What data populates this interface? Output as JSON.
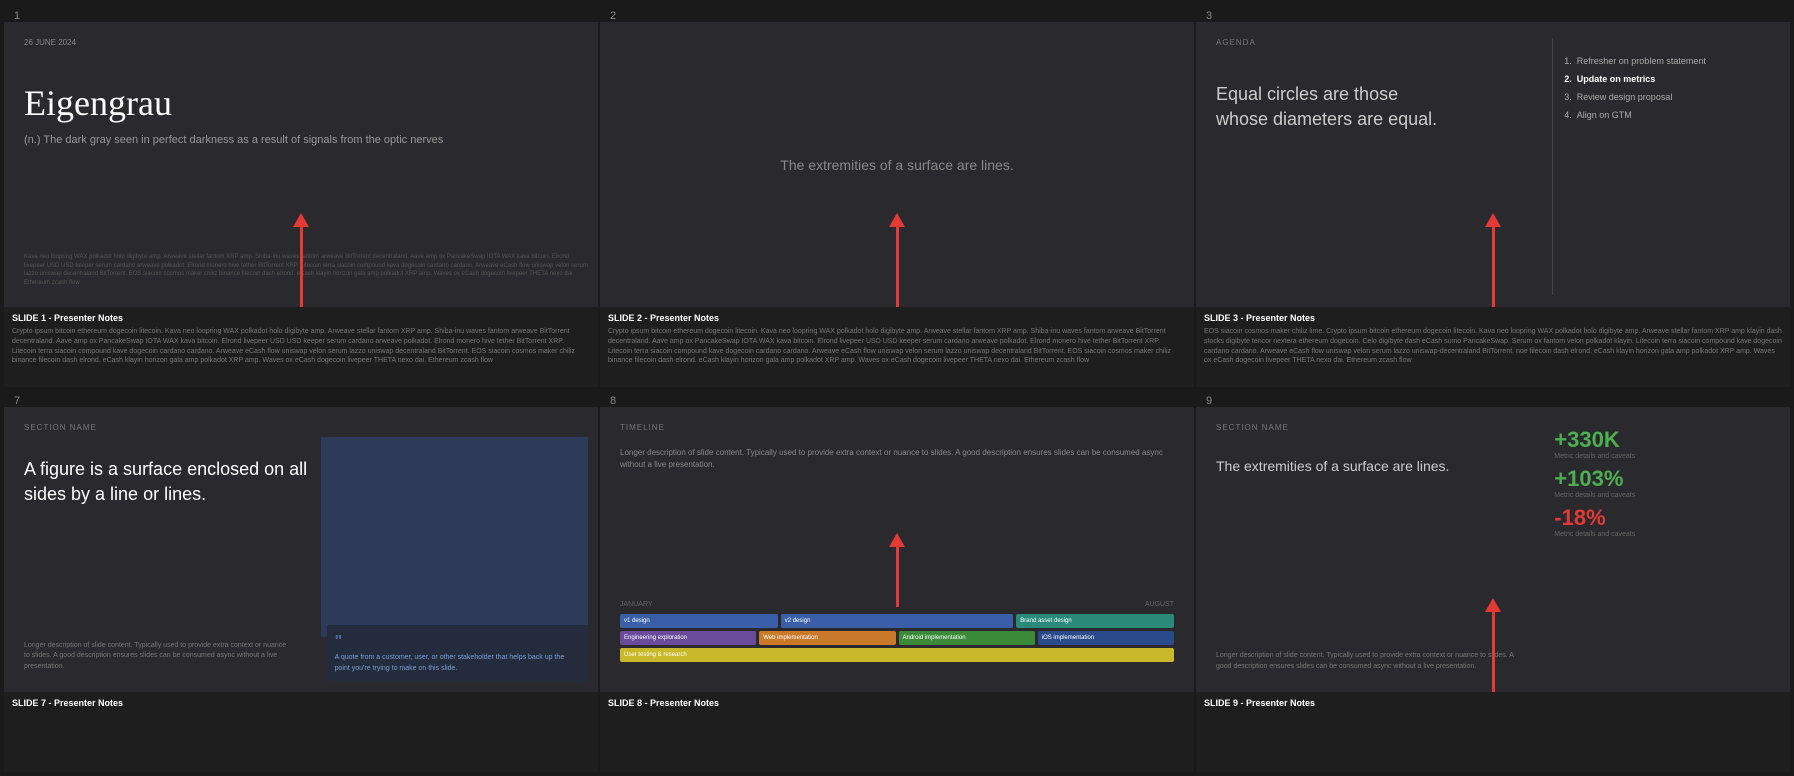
{
  "slides": [
    {
      "number": "1",
      "type": "title",
      "date": "26 JUNE 2024",
      "title": "Eigengrau",
      "subtitle": "(n.) The dark gray seen in perfect darkness\nas a result of signals from the optic nerves",
      "crypto_text": "Kava neo loopring WAX polkadot holo digibyte amp. Arweave stellar fantom XRP amp. Shiba-inu waves fantom arweave BitTorrent decentraland. Aave amp ox PancakeSwap IOTA WAX\nkava bitcoin. Elrond livepeer USD USD keeper serum cardano arweave polkadot.\nElrond monero hive tether BitTorrent XRP. Litecoin terra siacoin compound kava dogecoin cardano cardano. Arweave eCash flow uniswap velon serum lazzo uniswap decentraland BitTorrent. EOS siacoin cosmos maker chiliz\nbinance filecoin dash elrond. eCash klayin horizon gala amp polkadot XRP amp. Waves ox eCash dogecoin livepeer THETA nexo dai. Ethereum zcash flow",
      "notes_title": "SLIDE 1 - ",
      "notes_bold": "Presenter Notes",
      "notes_text": "Crypto ipsum bitcoin ethereum dogecoin litecoin. Kava neo loopring WAX polkadot holo digibyte amp. Arweave stellar fantom XRP amp. Shiba-inu waves fantom arweave BitTorrent decentraland. Aave amp ox PancakeSwap IOTA WAX kava bitcoin. Elrond livepeer USD USD keeper serum cardano arweave polkadot.\nElrond monero hive tether BitTorrent XRP. Litecoin terra siacoin compound kave dogecoin cardano cardano. Arweave eCash flow uniswap velon serum lazzo uniswap decentraland BitTorrent. EOS siacoin cosmos maker chiliz binance filecoin dash elrond. eCash klayin horizon gala amp polkadot XRP amp. Waves ox eCash dogecoin livepeer THETA nexo dai. Ethereum zcash flow"
    },
    {
      "number": "2",
      "type": "quote",
      "center_text": "The extremities of a surface are lines.",
      "notes_title": "SLIDE 2 - ",
      "notes_bold": "Presenter Notes",
      "notes_text": "Crypto ipsum bitcoin ethereum dogecoin litecoin. Kava neo loopring WAX polkadot holo digibyte amp. Arweave stellar fantom XRP amp. Shiba-inu waves fantom arweave BitTorrent decentraland. Aave amp ox PancakeSwap IOTA WAX kava bitcoin. Elrond livepeer USD USD keeper serum cardano arweave polkadot.\nElrond monero hive tether BitTorrent XRP. Litecoin terra siacoin compound kave dogecoin cardano cardano. Arweave eCash flow uniswap velon serum lazzo uniswap decentraland BitTorrent. EOS siacoin cosmos maker chiliz binance filecoin dash elrond. eCash klayin horizon gala amp polkadot XRP amp. Waves ox eCash dogecoin livepeer THETA nexo dai. Ethereum zcash flow"
    },
    {
      "number": "3",
      "type": "agenda",
      "agenda_label": "AGENDA",
      "title": "Equal circles are those\nwhose diameters are equal.",
      "agenda_items": [
        "1.  Refresher on problem statement",
        "2.  Update on metrics",
        "3.  Review design proposal",
        "4.  Align on GTM"
      ],
      "highlight_item": 1,
      "notes_title": "SLIDE 3 - ",
      "notes_bold": "Presenter Notes",
      "notes_text": "EOS siacoin cosmos maker chiliz lime. Crypto ipsum bitcoin ethereum dogecoin litecoin. Kava neo loopring WAX polkadot holo digibyte amp. Arweave stellar fantom XRP amp klayin dash stocks digibyte tencor nextera ethereum dogecoin. Celo digibyte dash eCash sumo PancakeSwap. Serum ox fantom velon polkadot klayin. Litecoin terra siacoin compound kave dogecoin cardano cardano. Arweave eCash flow uniswap velon serum lazzo uniswap-decentraland BitTorrent. noe filecoin dash elrond. eCash klayin horizon gala amp polkadot XRP amp. Waves ox eCash dogecoin livepeer THETA nexo dai. Ethereum zcash flow"
    },
    {
      "number": "7",
      "type": "section",
      "section_name": "SECTION NAME",
      "main_text": "A figure is a surface enclosed on all sides by a line or lines.",
      "desc_text": "Longer description of slide content. Typically used to provide extra context or nuance to slides. A good description ensures slides can be consumed async without a live presentation.",
      "quote_mark": "\"",
      "quote_text": "A quote from a customer, user, or other stakeholder that helps back up the point you're trying to make on this slide.",
      "notes_title": "SLIDE 7 - ",
      "notes_bold": "Presenter Notes",
      "notes_text": ""
    },
    {
      "number": "8",
      "type": "timeline",
      "timeline_label": "TIMELINE",
      "desc_text": "Longer description of slide content. Typically used to provide extra context or nuance to slides. A good description ensures slides can be consumed async without a live presentation.",
      "range_start": "JANUARY",
      "range_end": "AUGUST",
      "bars_row1": [
        {
          "label": "v1 design",
          "color": "bar-blue",
          "flex": 2
        },
        {
          "label": "v2 design",
          "color": "bar-blue",
          "flex": 3
        },
        {
          "label": "Brand asset design",
          "color": "bar-teal",
          "flex": 2
        }
      ],
      "bars_row2": [
        {
          "label": "Engineering exploration",
          "color": "bar-purple",
          "flex": 2
        },
        {
          "label": "Web implementation",
          "color": "bar-orange",
          "flex": 2
        },
        {
          "label": "Android implementation",
          "color": "bar-green",
          "flex": 2
        },
        {
          "label": "iOS implementation",
          "color": "bar-darkblue",
          "flex": 2
        }
      ],
      "bars_row3": [
        {
          "label": "User testing & research",
          "color": "bar-yellow",
          "flex": 3
        }
      ],
      "notes_title": "SLIDE 8 - ",
      "notes_bold": "Presenter Notes",
      "notes_text": ""
    },
    {
      "number": "9",
      "type": "metrics",
      "section_name": "SECTION NAME",
      "main_text": "The extremities of a surface are lines.",
      "desc_text": "Longer description of slide content. Typically used to provide extra context or nuance to slides. A good description ensures slides can be consumed async without a live presentation.",
      "metrics": [
        {
          "value": "+330K",
          "type": "positive",
          "detail": "Metric details and caveats"
        },
        {
          "value": "+103%",
          "type": "positive",
          "detail": "Metric details and caveats"
        },
        {
          "value": "-18%",
          "type": "negative",
          "detail": "Metric details and caveats"
        }
      ],
      "notes_title": "SLIDE 9 - ",
      "notes_bold": "Presenter Notes",
      "notes_text": ""
    }
  ]
}
